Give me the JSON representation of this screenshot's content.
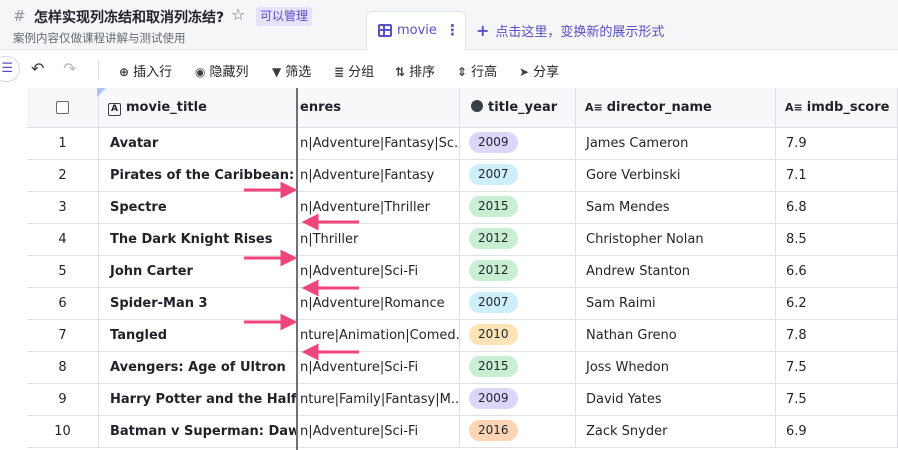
{
  "header": {
    "hash": "#",
    "title": "怎样实现列冻结和取消列冻结?",
    "star": "☆",
    "permission": "可以管理",
    "subtitle": "案例内容仅做课程讲解与测试使用"
  },
  "view": {
    "tab_label": "movie",
    "more": "⋮",
    "add_plus": "+",
    "add_label": "点击这里，变换新的展示形式"
  },
  "toolbar": {
    "sidebar_icon": "☰",
    "undo": "↶",
    "redo": "↷",
    "buttons": [
      {
        "icon": "⊕",
        "label": "插入行"
      },
      {
        "icon": "◉",
        "label": "隐藏列"
      },
      {
        "icon": "▼",
        "label": "筛选"
      },
      {
        "icon": "≣",
        "label": "分组"
      },
      {
        "icon": "⇅",
        "label": "排序"
      },
      {
        "icon": "⇕",
        "label": "行高"
      },
      {
        "icon": "➤",
        "label": "分享"
      }
    ]
  },
  "columns": {
    "title": "movie_title",
    "genres": "enres",
    "year": "title_year",
    "director": "director_name",
    "score": "imdb_score"
  },
  "icons": {
    "title_icon": "A",
    "text_icon": "A≡"
  },
  "rows": [
    {
      "n": "1",
      "title": "Avatar",
      "genres": "n|Adventure|Fantasy|Sc...",
      "year": "2009",
      "director": "James Cameron",
      "score": "7.9"
    },
    {
      "n": "2",
      "title": "Pirates of the Caribbean: A...",
      "genres": "n|Adventure|Fantasy",
      "year": "2007",
      "director": "Gore Verbinski",
      "score": "7.1"
    },
    {
      "n": "3",
      "title": "Spectre",
      "genres": "n|Adventure|Thriller",
      "year": "2015",
      "director": "Sam Mendes",
      "score": "6.8"
    },
    {
      "n": "4",
      "title": "The Dark Knight Rises",
      "genres": "n|Thriller",
      "year": "2012",
      "director": "Christopher Nolan",
      "score": "8.5"
    },
    {
      "n": "5",
      "title": "John Carter",
      "genres": "n|Adventure|Sci-Fi",
      "year": "2012",
      "director": "Andrew Stanton",
      "score": "6.6"
    },
    {
      "n": "6",
      "title": "Spider-Man 3",
      "genres": "n|Adventure|Romance",
      "year": "2007",
      "director": "Sam Raimi",
      "score": "6.2"
    },
    {
      "n": "7",
      "title": "Tangled",
      "genres": "nture|Animation|Comed...",
      "year": "2010",
      "director": "Nathan Greno",
      "score": "7.8"
    },
    {
      "n": "8",
      "title": "Avengers: Age of Ultron",
      "genres": "n|Adventure|Sci-Fi",
      "year": "2015",
      "director": "Joss Whedon",
      "score": "7.5"
    },
    {
      "n": "9",
      "title": "Harry Potter and the Half-...",
      "genres": "nture|Family|Fantasy|M...",
      "year": "2009",
      "director": "David Yates",
      "score": "7.5"
    },
    {
      "n": "10",
      "title": "Batman v Superman: Daw...",
      "genres": "n|Adventure|Sci-Fi",
      "year": "2016",
      "director": "Zack Snyder",
      "score": "6.9"
    }
  ],
  "year_colors": {
    "2007": {
      "bg": "#cdeefb",
      "fg": "#1f2329"
    },
    "2009": {
      "bg": "#ddd6fb",
      "fg": "#1f2329"
    },
    "2010": {
      "bg": "#fde3b5",
      "fg": "#1f2329"
    },
    "2012": {
      "bg": "#c9efd3",
      "fg": "#1f2329"
    },
    "2015": {
      "bg": "#c9efd3",
      "fg": "#1f2329"
    },
    "2016": {
      "bg": "#fdd4b4",
      "fg": "#1f2329"
    }
  },
  "theme": {
    "accent": "#5a4fc4",
    "arrow": "#f0457b",
    "frozen_line": "#6e7278"
  }
}
